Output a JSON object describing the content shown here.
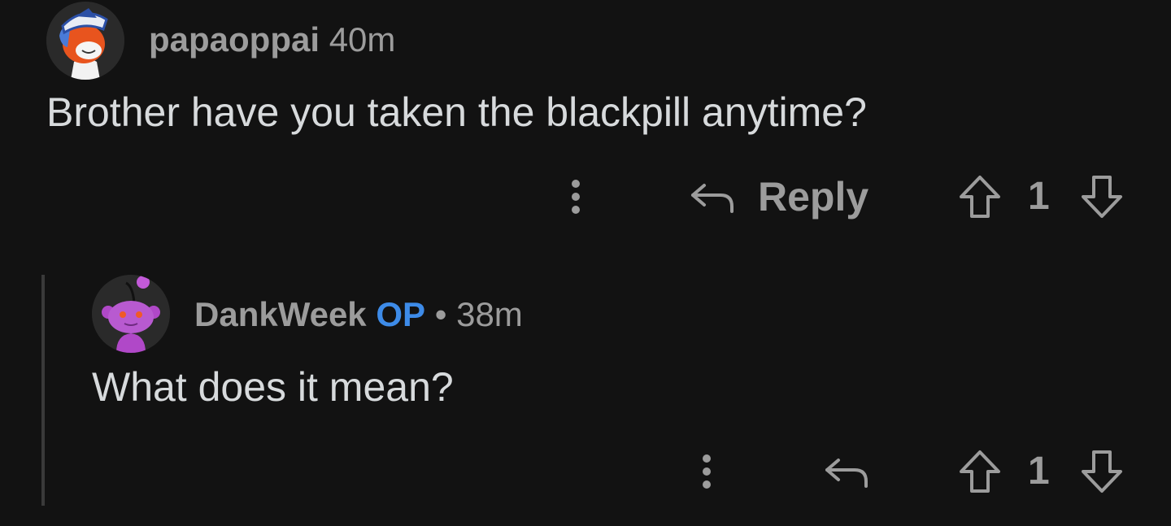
{
  "comments": [
    {
      "username": "papaoppai",
      "time": "40m",
      "body": "Brother have you taken the blackpill anytime?",
      "reply_label": "Reply",
      "score": "1"
    },
    {
      "username": "DankWeek",
      "op_badge": "OP",
      "separator": "•",
      "time": "38m",
      "body": "What does it mean?",
      "score": "1"
    }
  ],
  "colors": {
    "background": "#121212",
    "meta_text": "#9c9c9c",
    "body_text": "#d7dadc",
    "op_badge": "#3d8be8",
    "thread_line": "#3a3a3a"
  },
  "icons": [
    "more-options-icon",
    "reply-arrow-icon",
    "upvote-arrow-icon",
    "downvote-arrow-icon"
  ]
}
